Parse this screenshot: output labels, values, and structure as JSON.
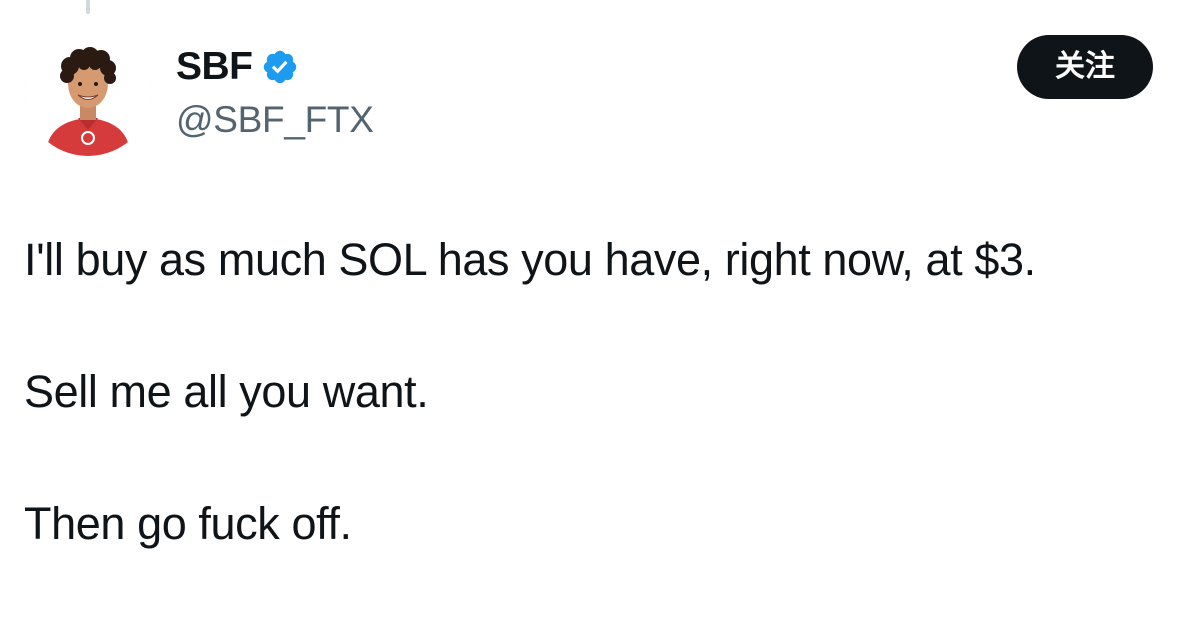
{
  "author": {
    "display_name": "SBF",
    "handle": "@SBF_FTX",
    "verified": true,
    "avatar_icon": "avatar-illustration",
    "verified_color": "#1d9bf0"
  },
  "actions": {
    "follow_label": "关注"
  },
  "tweet": {
    "lines": [
      "I'll buy as much SOL has you have, right now, at $3.",
      "Sell me all you want.",
      "Then go fuck off."
    ]
  },
  "colors": {
    "text": "#0f1419",
    "secondary_text": "#536471",
    "button_bg": "#0f1419",
    "button_text": "#ffffff"
  }
}
